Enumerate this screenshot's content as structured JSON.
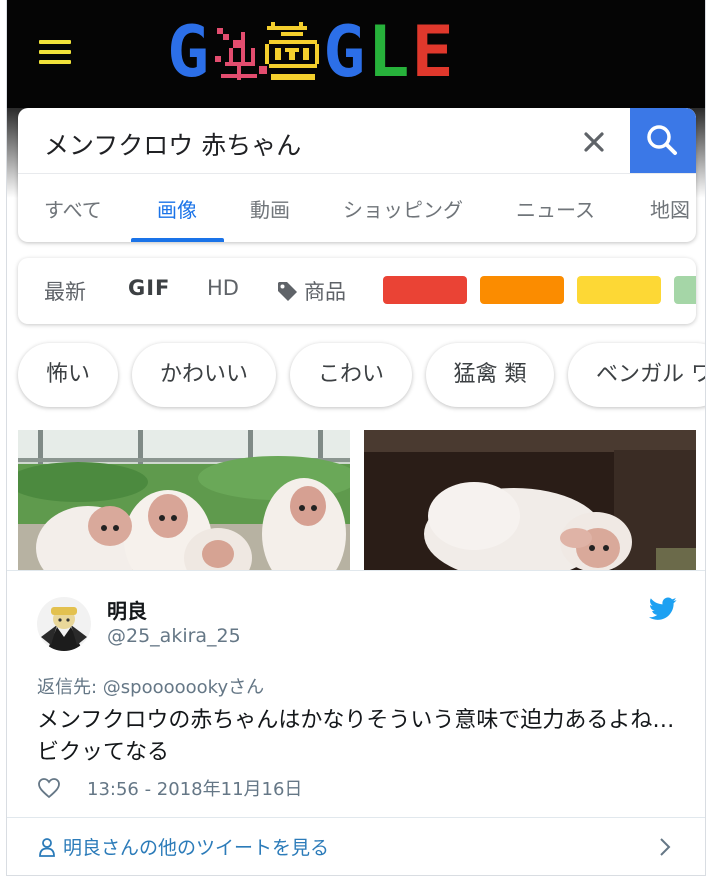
{
  "google": {
    "doodle": {
      "letters_left": "G",
      "letters_right": [
        "G",
        "L",
        "E"
      ],
      "colors": {
        "blue": "#2c6fe8",
        "green": "#27b23b",
        "red": "#e0382c",
        "yellow": "#f4cf2d",
        "pink": "#e34d6f"
      }
    },
    "search": {
      "query": "メンフクロウ 赤ちゃん",
      "clear_icon": "close-icon",
      "search_icon": "magnifier-icon"
    },
    "tabs": [
      {
        "label": "すべて",
        "active": false
      },
      {
        "label": "画像",
        "active": true
      },
      {
        "label": "動画",
        "active": false
      },
      {
        "label": "ショッピング",
        "active": false
      },
      {
        "label": "ニュース",
        "active": false
      },
      {
        "label": "地図",
        "active": false
      }
    ],
    "filters": {
      "latest": "最新",
      "gif": "GIF",
      "hd": "HD",
      "products": "商品",
      "products_icon": "tag-icon",
      "color_swatches": [
        "#ea4335",
        "#fb8c00",
        "#fdd835",
        "#a5d6a7"
      ]
    },
    "chips": [
      "怖い",
      "かわいい",
      "こわい",
      "猛禽 類",
      "ベンガル ワ"
    ]
  },
  "tweet": {
    "display_name": "明良",
    "handle": "@25_akira_25",
    "reply_prefix": "返信先: ",
    "reply_mention": "@spooooooky",
    "reply_suffix": "さん",
    "text": "メンフクロウの赤ちゃんはかなりそういう意味で迫力あるよね…ビクッてなる",
    "timestamp": "13:56 - 2018年11月16日",
    "more_link": "明良さんの他のツイートを見る",
    "brand_icon": "twitter-bird-icon",
    "colors": {
      "link": "#2b7bb9",
      "bird": "#1da1f2",
      "muted": "#657786"
    }
  }
}
